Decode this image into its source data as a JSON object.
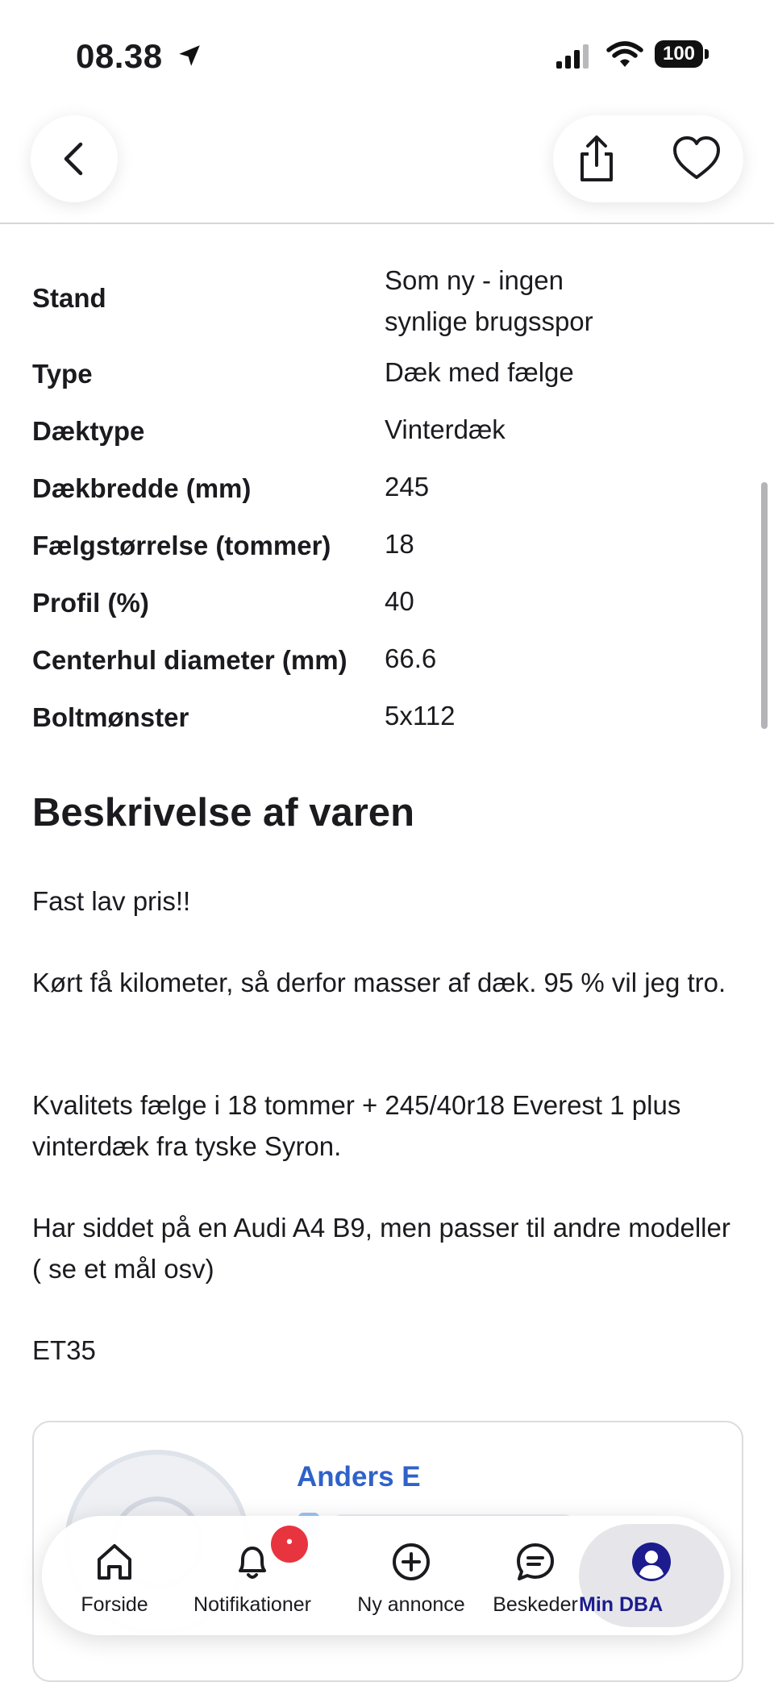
{
  "status_bar": {
    "time": "08.38",
    "battery": "100"
  },
  "specs": [
    {
      "label": "Stand",
      "value_lines": [
        "Som ny - ingen",
        "synlige brugsspor"
      ]
    },
    {
      "label": "Type",
      "value": "Dæk med fælge"
    },
    {
      "label": "Dæktype",
      "value": "Vinterdæk"
    },
    {
      "label": "Dækbredde (mm)",
      "value": "245"
    },
    {
      "label": "Fælgstørrelse (tommer)",
      "value": "18"
    },
    {
      "label": "Profil (%)",
      "value": "40"
    },
    {
      "label": "Centerhul diameter (mm)",
      "value": "66.6"
    },
    {
      "label": "Boltmønster",
      "value": "5x112"
    }
  ],
  "description": {
    "title": "Beskrivelse af varen",
    "paragraphs": [
      "Fast lav pris!!",
      "Kørt få kilometer, så derfor masser af dæk. 95 % vil jeg tro.",
      "Kvalitets fælge i 18 tommer + 245/40r18 Everest 1 plus vinterdæk fra tyske Syron.",
      "Har siddet på en Audi A4 B9, men passer til andre modeller ( se et mål osv)",
      "ET35"
    ]
  },
  "seller": {
    "name": "Anders E"
  },
  "tab_bar": {
    "tabs": [
      {
        "label": "Forside",
        "icon": "home-icon"
      },
      {
        "label": "Notifikationer",
        "icon": "bell-icon"
      },
      {
        "label": "Ny annonce",
        "icon": "plus-circle-icon"
      },
      {
        "label": "Beskeder",
        "icon": "chat-icon"
      },
      {
        "label": "Min DBA",
        "icon": "user-icon",
        "active": true
      }
    ],
    "notification_badge": "•"
  },
  "colors": {
    "accent": "#1c1c8f",
    "link": "#2f62c9",
    "badge": "#e8343f"
  }
}
